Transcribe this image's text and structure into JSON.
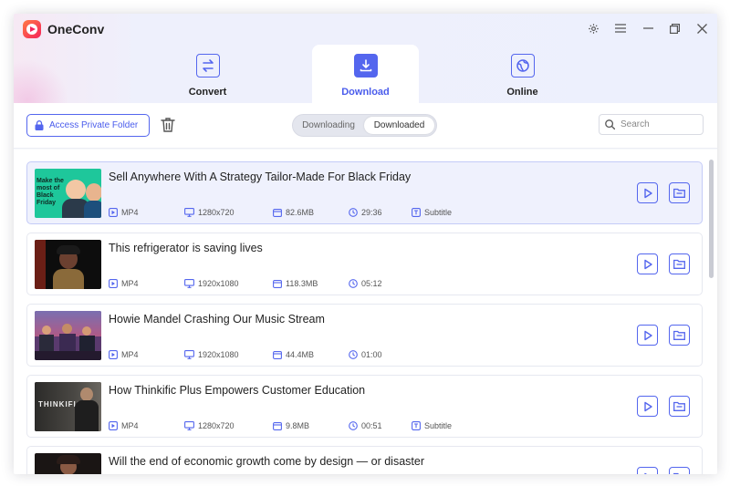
{
  "app": {
    "title": "OneConv"
  },
  "tabs": [
    {
      "label": "Convert",
      "icon": "convert-arrows-icon"
    },
    {
      "label": "Download",
      "icon": "download-icon",
      "active": true
    },
    {
      "label": "Online",
      "icon": "globe-icon"
    }
  ],
  "toolbar": {
    "private_folder_label": "Access Private Folder",
    "segment": {
      "options": [
        "Downloading",
        "Downloaded"
      ],
      "selected": "Downloaded"
    },
    "search_placeholder": "Search"
  },
  "videos": [
    {
      "title": "Sell Anywhere With A Strategy Tailor-Made For Black Friday",
      "format": "MP4",
      "resolution": "1280x720",
      "size": "82.6MB",
      "duration": "29:36",
      "subtitle": "Subtitle",
      "thumb_text": "Make the most of Black Friday"
    },
    {
      "title": "This refrigerator is saving lives",
      "format": "MP4",
      "resolution": "1920x1080",
      "size": "118.3MB",
      "duration": "05:12"
    },
    {
      "title": "Howie Mandel Crashing Our Music Stream",
      "format": "MP4",
      "resolution": "1920x1080",
      "size": "44.4MB",
      "duration": "01:00"
    },
    {
      "title": "How Thinkific Plus Empowers Customer Education",
      "format": "MP4",
      "resolution": "1280x720",
      "size": "9.8MB",
      "duration": "00:51",
      "subtitle": "Subtitle",
      "thumb_text": "THINKIFIC+"
    },
    {
      "title": "Will the end of economic growth come by design — or disaster"
    }
  ],
  "colors": {
    "accent": "#5466ee",
    "selected_row": "#eff1fd"
  }
}
